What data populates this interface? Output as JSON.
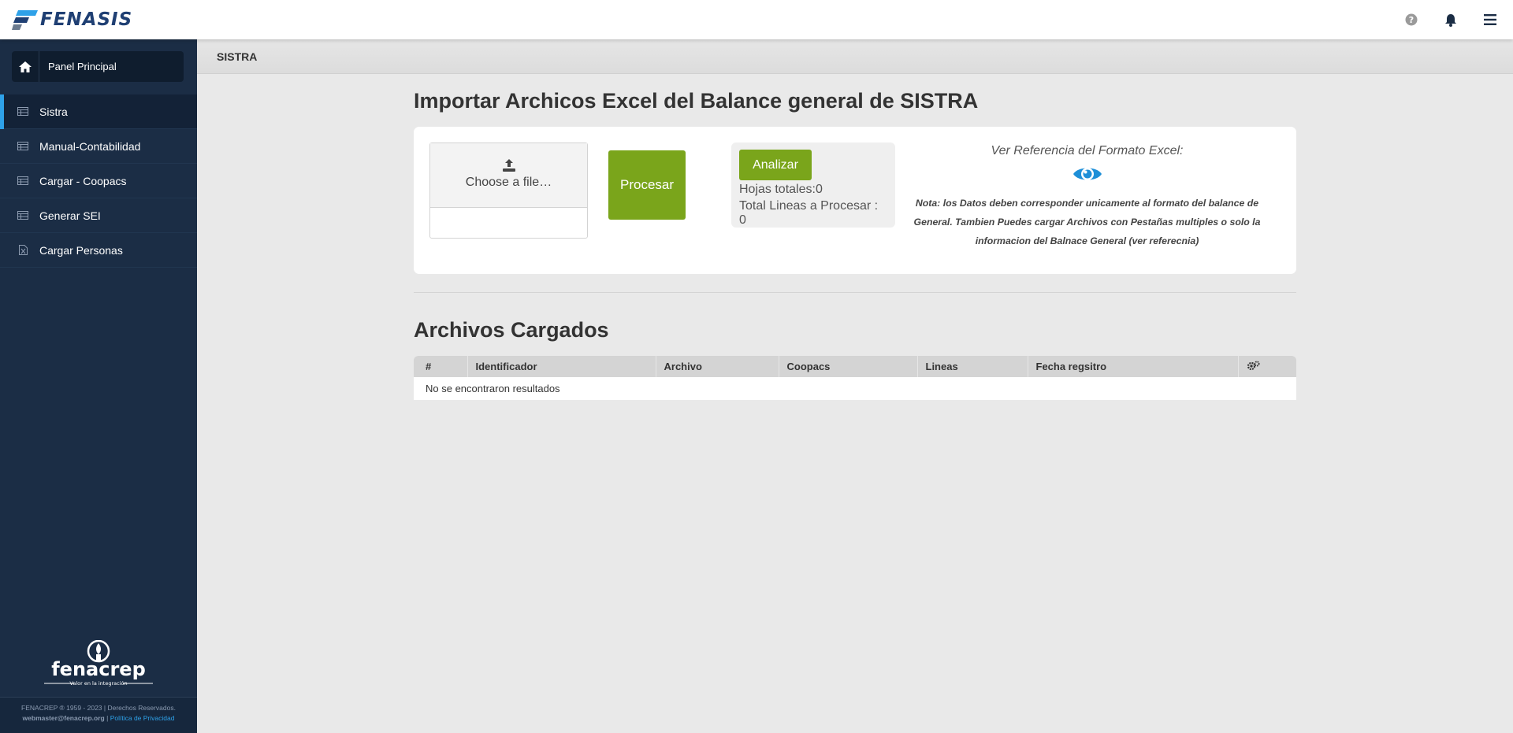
{
  "app": {
    "logo_text": "FENASIS"
  },
  "topbar": {
    "icons": [
      "help-icon",
      "bell-icon",
      "menu-icon"
    ]
  },
  "sidebar": {
    "panel_label": "Panel Principal",
    "items": [
      {
        "label": "Sistra",
        "icon": "table-icon",
        "active": true
      },
      {
        "label": "Manual-Contabilidad",
        "icon": "table-icon",
        "active": false
      },
      {
        "label": "Cargar - Coopacs",
        "icon": "table-icon",
        "active": false
      },
      {
        "label": "Generar SEI",
        "icon": "table-icon",
        "active": false
      },
      {
        "label": "Cargar Personas",
        "icon": "file-excel-icon",
        "active": false
      }
    ],
    "footer_logo_text": "fenacrep",
    "footer_logo_tagline": "Valor en la integración",
    "footer_line1": "FENACREP ® 1959 - 2023 | Derechos Reservados.",
    "footer_email": "webmaster@fenacrep.org",
    "footer_sep": "|",
    "footer_privacy": "Política de Privacidad"
  },
  "breadcrumb": {
    "label": "SISTRA"
  },
  "main": {
    "title": "Importar Archicos Excel del Balance general de SISTRA",
    "file_input_label": "Choose a file…",
    "process_button": "Procesar",
    "analyze_button": "Analizar",
    "sheets_total": "Hojas totales:0",
    "lines_total": "Total Lineas a Procesar : 0",
    "ref_title": "Ver Referencia del Formato Excel:",
    "note": "Nota: los Datos deben corresponder unicamente al formato del balance de General. Tambien Puedes cargar Archivos con Pestañas multiples o solo la informacion del Balnace General (ver referecnia)",
    "uploaded_title": "Archivos Cargados",
    "table": {
      "columns": [
        "#",
        "Identificador",
        "Archivo",
        "Coopacs",
        "Lineas",
        "Fecha regsitro"
      ],
      "empty_message": "No se encontraron resultados"
    }
  },
  "colors": {
    "sidebar_bg": "#1b2d45",
    "accent_blue": "#2ea1e8",
    "button_green": "#7aa51b",
    "page_bg": "#e9e9e9"
  }
}
